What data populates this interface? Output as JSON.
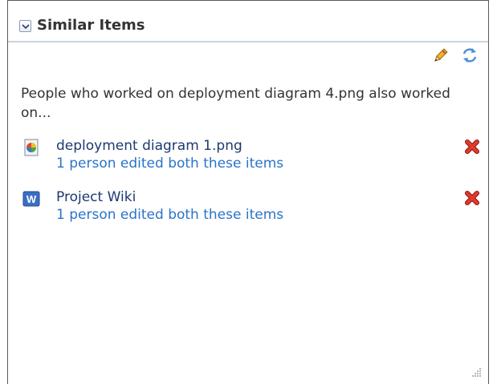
{
  "panel": {
    "title": "Similar Items",
    "collapse_icon": "chevron-down-icon",
    "toolbar": {
      "edit_icon": "pencil-icon",
      "refresh_icon": "refresh-icon"
    },
    "intro_text": "People who worked on deployment diagram 4.png also worked on...",
    "items": [
      {
        "icon": "image-file-icon",
        "title": "deployment diagram 1.png",
        "subtitle": "1 person edited both these items",
        "remove_icon": "red-x-icon"
      },
      {
        "icon": "wiki-icon",
        "title": "Project Wiki",
        "subtitle": "1 person edited both these items",
        "remove_icon": "red-x-icon"
      }
    ],
    "resize_icon": "resize-grip-icon"
  },
  "colors": {
    "link_primary": "#1c3a70",
    "link_secondary": "#2a73c9",
    "header_rule": "#c8d3e0",
    "remove_red": "#d8261c"
  }
}
